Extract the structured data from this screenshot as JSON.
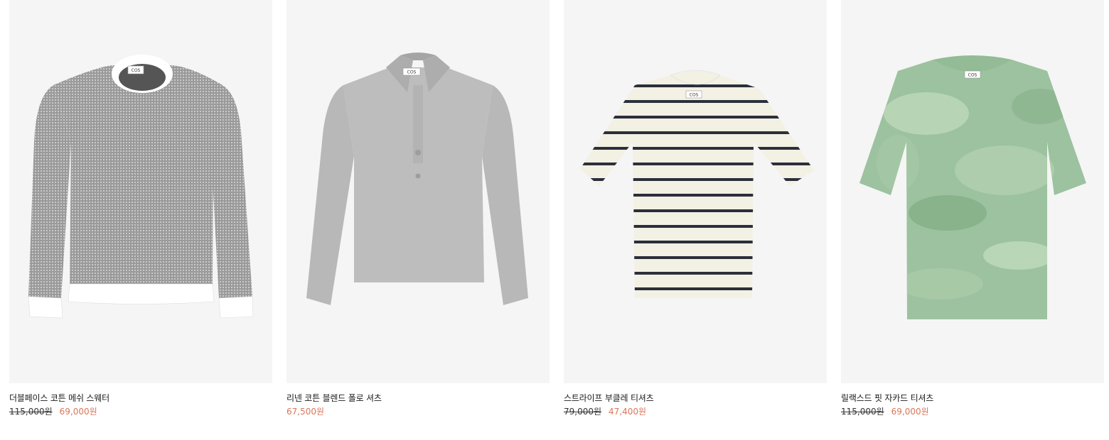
{
  "colors": {
    "background": "#ffffff",
    "image_bg": "#f5f5f5",
    "sale_price": "#d9765a",
    "text": "#1a1a1a"
  },
  "products": [
    {
      "name": "더블페이스 코튼 메쉬 스웨터",
      "original_price": "115,000원",
      "sale_price": "69,000원",
      "image": "grey-mesh-sweater-white-trim",
      "label": "COS"
    },
    {
      "name": "리넨 코튼 블렌드 폴로 셔츠",
      "original_price": "",
      "sale_price": "67,500원",
      "image": "grey-linen-polo-shirt",
      "label": "COS"
    },
    {
      "name": "스트라이프 부클레 티셔츠",
      "original_price": "79,000원",
      "sale_price": "47,400원",
      "image": "cream-navy-striped-tshirt",
      "label": "COS"
    },
    {
      "name": "릴랙스드 핏 자카드 티셔츠",
      "original_price": "115,000원",
      "sale_price": "69,000원",
      "image": "green-camo-jacquard-tshirt",
      "label": "COS"
    }
  ]
}
